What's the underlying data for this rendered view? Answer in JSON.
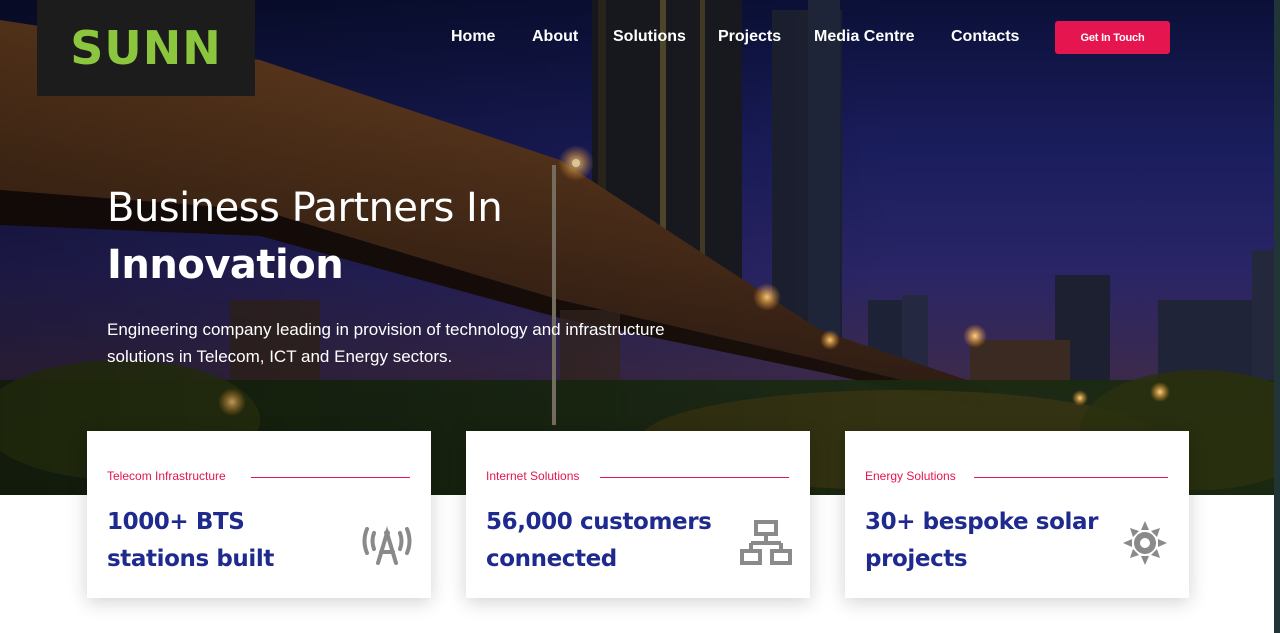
{
  "brand": {
    "logo_text": "SUNN",
    "logo_color": "#8cc63f"
  },
  "nav": {
    "items": [
      {
        "label": "Home"
      },
      {
        "label": "About"
      },
      {
        "label": "Solutions"
      },
      {
        "label": "Projects"
      },
      {
        "label": "Media Centre"
      },
      {
        "label": "Contacts"
      }
    ],
    "cta_label": "Get In Touch"
  },
  "hero": {
    "title_line1": "Business Partners In",
    "title_line2": "Innovation",
    "subtitle": "Engineering company leading in provision of technology and infrastructure solutions in Telecom, ICT and Energy sectors."
  },
  "cards": [
    {
      "kicker": "Telecom Infrastructure",
      "title": "1000+ BTS stations built",
      "icon": "antenna-icon"
    },
    {
      "kicker": "Internet Solutions",
      "title": "56,000 customers connected",
      "icon": "network-icon"
    },
    {
      "kicker": "Energy Solutions",
      "title": "30+ bespoke solar projects",
      "icon": "sun-icon"
    }
  ],
  "colors": {
    "accent": "#e5154f",
    "card_title": "#1f2a8e",
    "icon_gray": "#8a8a8a"
  }
}
